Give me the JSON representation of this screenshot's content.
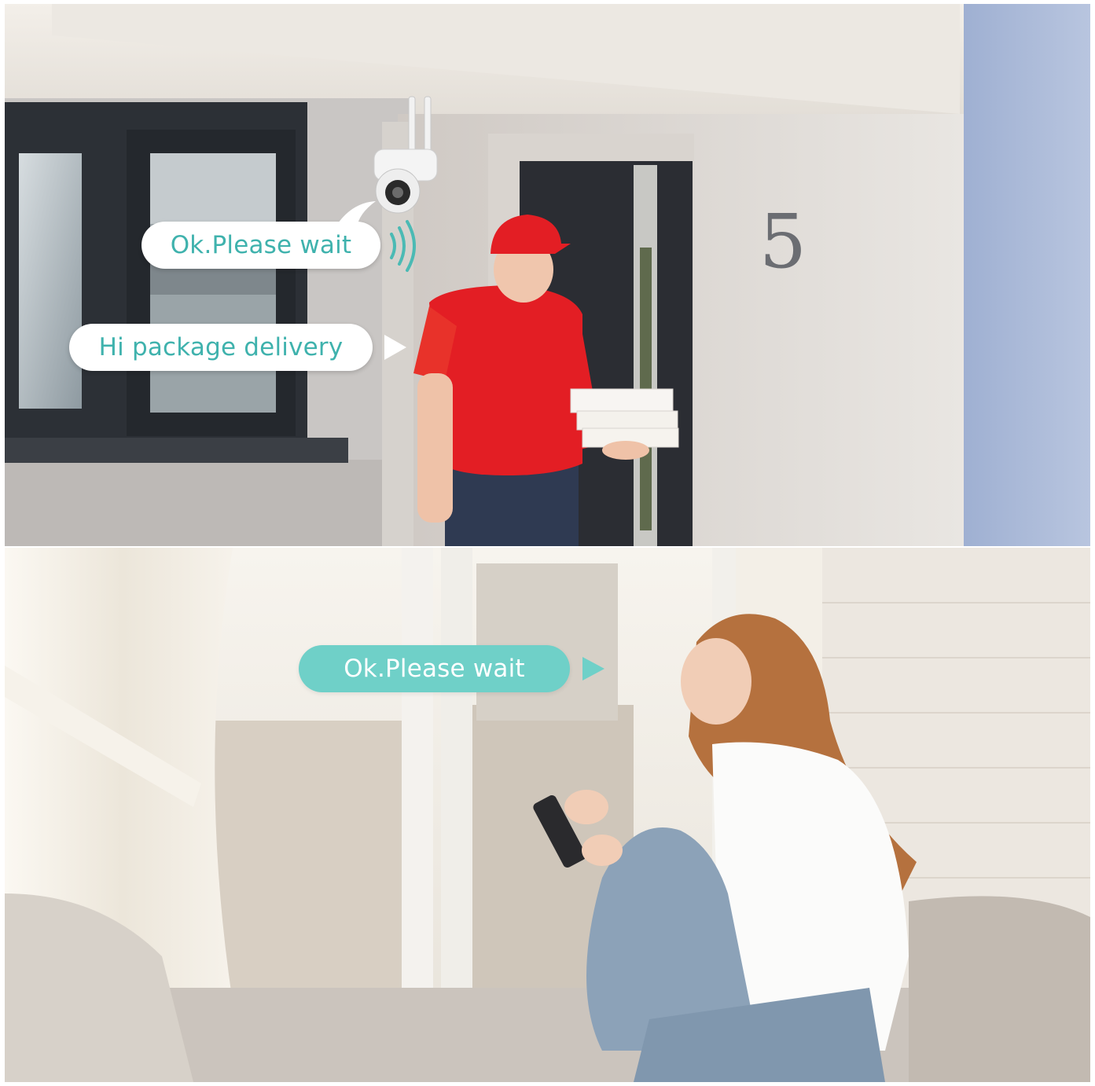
{
  "scene_top": {
    "camera_bubble": {
      "text": "Ok.Please wait"
    },
    "courier_bubble": {
      "text": "Hi package delivery"
    },
    "house_number": "5"
  },
  "scene_bottom": {
    "phone_bubble": {
      "text": "Ok.Please wait"
    }
  },
  "colors": {
    "accent_teal": "#3fb2ad",
    "bubble_teal_fill": "#6fd0c8",
    "shirt_red": "#e31e24"
  },
  "icons": [
    "sound-waves-icon",
    "play-triangle-icon",
    "ptz-camera-icon"
  ]
}
